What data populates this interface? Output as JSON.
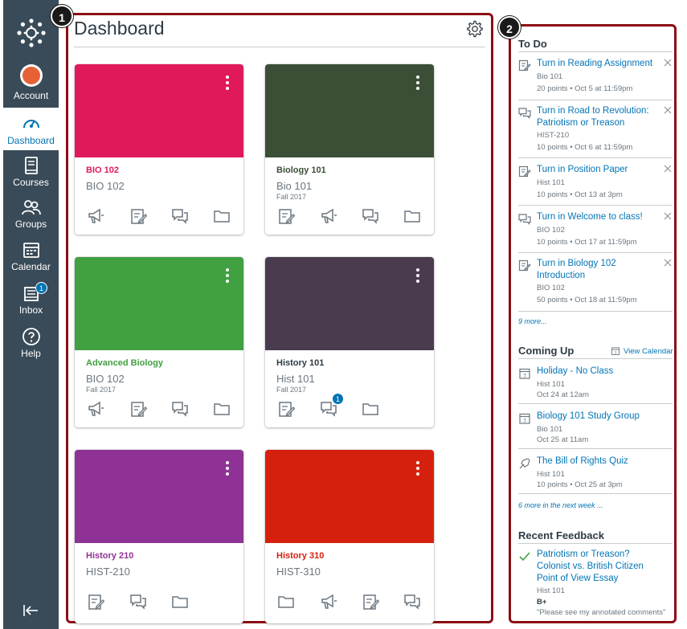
{
  "global_nav": {
    "account_label": "Account",
    "dashboard_label": "Dashboard",
    "courses_label": "Courses",
    "groups_label": "Groups",
    "calendar_label": "Calendar",
    "inbox_label": "Inbox",
    "inbox_badge": "1",
    "help_label": "Help"
  },
  "callouts": {
    "one": "1",
    "two": "2"
  },
  "dashboard": {
    "title": "Dashboard",
    "cards": [
      {
        "title": "BIO 102",
        "code": "BIO 102",
        "term": "",
        "color": "#e0195a",
        "badge": ""
      },
      {
        "title": "Biology 101",
        "code": "Bio 101",
        "term": "Fall 2017",
        "color": "#3b4f37",
        "badge": ""
      },
      {
        "title": "Advanced Biology",
        "code": "BIO 102",
        "term": "Fall 2017",
        "color": "#40a042",
        "badge": ""
      },
      {
        "title": "History 101",
        "code": "Hist 101",
        "term": "Fall 2017",
        "color": "#4a3b4e",
        "badge": "1"
      },
      {
        "title": "History 210",
        "code": "HIST-210",
        "term": "",
        "color": "#8e3296",
        "badge": ""
      },
      {
        "title": "History 310",
        "code": "HIST-310",
        "term": "",
        "color": "#d6200e",
        "badge": ""
      }
    ]
  },
  "todo": {
    "heading": "To Do",
    "items": [
      {
        "title": "Turn in Reading Assignment",
        "course": "Bio 101",
        "meta": "20 points • Oct 5 at 11:59pm"
      },
      {
        "title": "Turn in Road to Revolution: Patriotism or Treason",
        "course": "HIST-210",
        "meta": "10 points • Oct 6 at 11:59pm"
      },
      {
        "title": "Turn in Position Paper",
        "course": "Hist 101",
        "meta": "10 points • Oct 13 at 3pm"
      },
      {
        "title": "Turn in Welcome to class!",
        "course": "BIO 102",
        "meta": "10 points • Oct 17 at 11:59pm"
      },
      {
        "title": "Turn in Biology 102 Introduction",
        "course": "BIO 102",
        "meta": "50 points • Oct 18 at 11:59pm"
      }
    ],
    "more": "9 more..."
  },
  "coming_up": {
    "heading": "Coming Up",
    "view_calendar": "View Calendar",
    "items": [
      {
        "title": "Holiday - No Class",
        "course": "Hist 101",
        "meta": "Oct 24 at 12am"
      },
      {
        "title": "Biology 101 Study Group",
        "course": "Bio 101",
        "meta": "Oct 25 at 11am"
      },
      {
        "title": "The Bill of Rights Quiz",
        "course": "Hist 101",
        "meta": "10 points • Oct 25 at 3pm"
      }
    ],
    "more": "6 more in the next week ..."
  },
  "recent_feedback": {
    "heading": "Recent Feedback",
    "item": {
      "title": "Patriotism or Treason? Colonist vs. British Citizen Point of View Essay",
      "course": "Hist 101",
      "grade": "B+",
      "comment": "\"Please see my annotated comments\""
    }
  }
}
